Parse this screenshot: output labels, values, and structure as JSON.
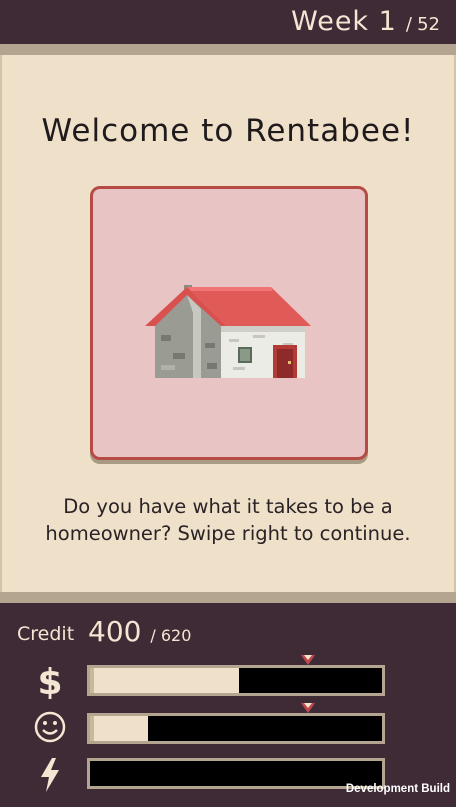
{
  "header": {
    "week_label": "Week 1",
    "week_separator": "/",
    "week_total": "52"
  },
  "card": {
    "title": "Welcome to Rentabee!",
    "image": "house-icon",
    "description": "Do you have what it takes to be a homeowner? Swipe right to continue."
  },
  "stats": {
    "credit_label": "Credit",
    "credit_value": "400",
    "credit_max": "/ 620",
    "bars": [
      {
        "name": "money",
        "icon": "dollar-icon",
        "fill": 0.51,
        "marker": 0.75
      },
      {
        "name": "happiness",
        "icon": "smiley-icon",
        "fill": 0.2,
        "marker": 0.75
      },
      {
        "name": "energy",
        "icon": "lightning-icon",
        "fill": 0.0,
        "marker": null
      }
    ]
  },
  "footer": {
    "dev_label": "Development Build"
  },
  "colors": {
    "frame": "#3e2b36",
    "paper": "#efe0c9",
    "card_bg": "#e8c5c4",
    "card_border": "#b64a44",
    "marker": "#c0484a"
  }
}
